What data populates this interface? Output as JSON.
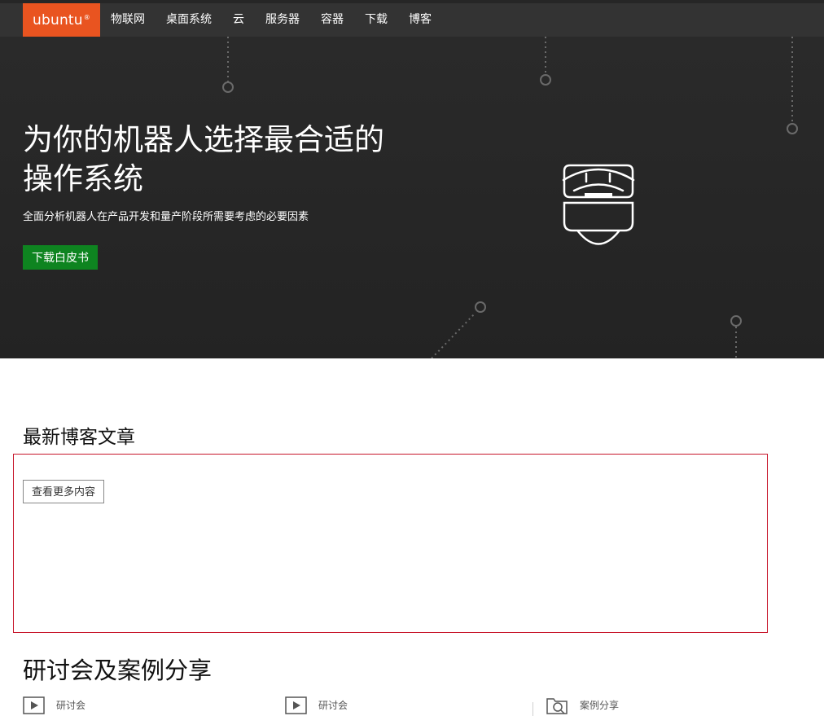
{
  "brand": {
    "name": "ubuntu",
    "mark": "®",
    "color": "#E95420"
  },
  "nav": {
    "items": [
      {
        "label": "物联网"
      },
      {
        "label": "桌面系统"
      },
      {
        "label": "云"
      },
      {
        "label": "服务器"
      },
      {
        "label": "容器"
      },
      {
        "label": "下载"
      },
      {
        "label": "博客"
      }
    ]
  },
  "hero": {
    "title": "为你的机器人选择最合适的操作系统",
    "subtitle": "全面分析机器人在产品开发和量产阶段所需要考虑的必要因素",
    "button_label": "下载白皮书",
    "button_color": "#0E8420",
    "illustration": "robot-icon"
  },
  "blog": {
    "heading": "最新博客文章",
    "more_label": "查看更多内容",
    "border_color": "#c7162b"
  },
  "webinars": {
    "heading": "研讨会及案例分享",
    "items": [
      {
        "icon": "play-icon",
        "label": "研讨会"
      },
      {
        "icon": "play-icon",
        "label": "研讨会"
      },
      {
        "icon": "folder-search-icon",
        "label": "案例分享"
      }
    ]
  }
}
